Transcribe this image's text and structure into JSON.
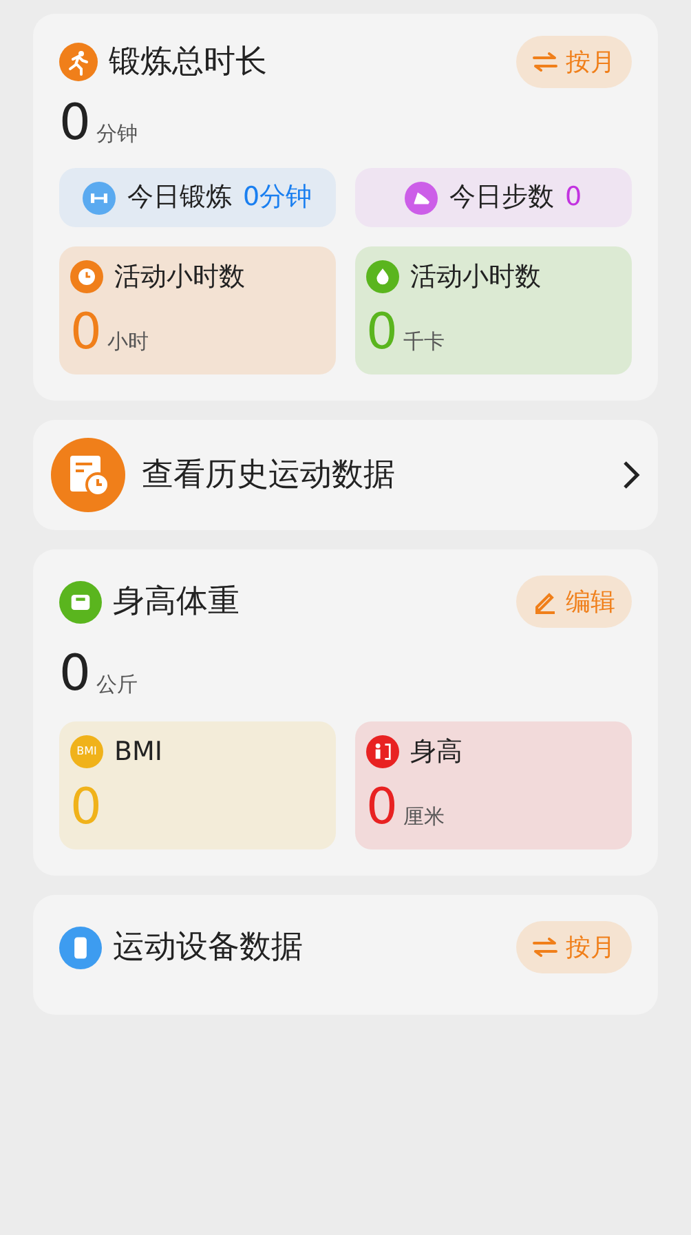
{
  "exercise": {
    "title": "锻炼总时长",
    "toggle": "按月",
    "total": {
      "value": "0",
      "unit": "分钟"
    },
    "chips": [
      {
        "label": "今日锻炼",
        "value": "0分钟",
        "color": "#1a7ff0"
      },
      {
        "label": "今日步数",
        "value": "0",
        "color": "#c233e0"
      }
    ],
    "tiles": [
      {
        "label": "活动小时数",
        "value": "0",
        "unit": "小时",
        "color": "#f07f1a"
      },
      {
        "label": "活动小时数",
        "value": "0",
        "unit": "千卡",
        "color": "#5ab51e"
      }
    ]
  },
  "history": {
    "label": "查看历史运动数据"
  },
  "body": {
    "title": "身高体重",
    "edit": "编辑",
    "total": {
      "value": "0",
      "unit": "公斤"
    },
    "tiles": [
      {
        "label": "BMI",
        "icon_text": "BMI",
        "value": "0",
        "color": "#f0b21a"
      },
      {
        "label": "身高",
        "value": "0",
        "unit": "厘米",
        "color": "#e82222"
      }
    ]
  },
  "devices": {
    "title": "运动设备数据",
    "toggle": "按月"
  }
}
